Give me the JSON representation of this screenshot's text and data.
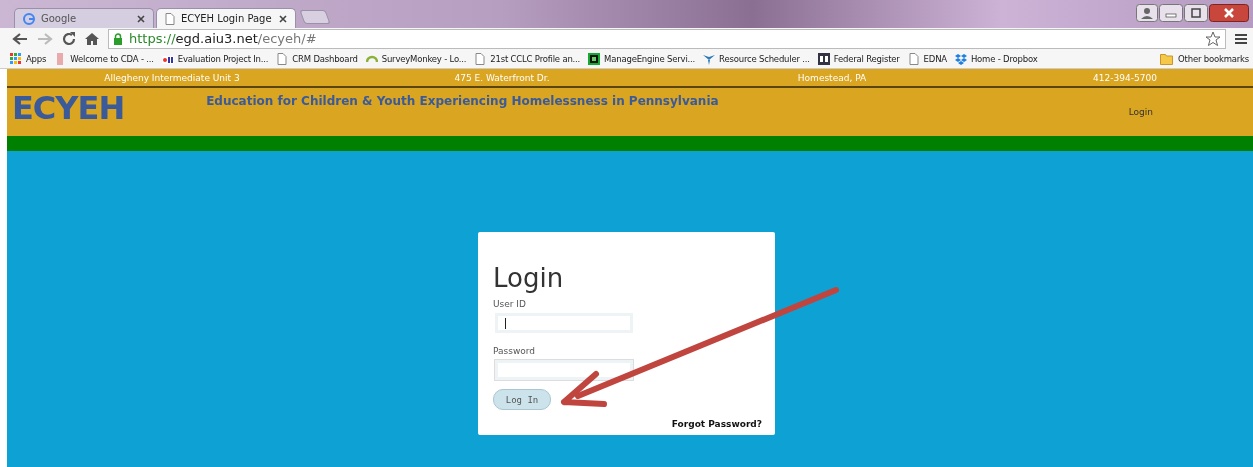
{
  "browser": {
    "tabs": [
      {
        "label": "Google",
        "selected": false
      },
      {
        "label": "ECYEH Login Page",
        "selected": true
      }
    ],
    "url": {
      "scheme": "https://",
      "host": "egd.aiu3.net",
      "path": "/ecyeh/#"
    },
    "bookmarks": [
      "Apps",
      "Welcome to CDA - ...",
      "Evaluation Project In...",
      "CRM Dashboard",
      "SurveyMonkey - Lo...",
      "21st CCLC Profile an...",
      "ManageEngine Servi...",
      "Resource Scheduler ...",
      "Federal Register",
      "EDNA",
      "Home - Dropbox"
    ],
    "other_bookmarks": "Other bookmarks"
  },
  "top_bar": [
    "Allegheny Intermediate Unit 3",
    "475 E. Waterfront Dr.",
    "Homestead, PA",
    "412-394-5700"
  ],
  "header": {
    "logo": "ECYEH",
    "tagline": "Education for Children & Youth Experiencing Homelessness in Pennsylvania",
    "nav_link": "Login"
  },
  "login": {
    "title": "Login",
    "fields": [
      {
        "label": "User ID",
        "focused": true
      },
      {
        "label": "Password",
        "focused": false
      }
    ],
    "button": "Log In",
    "forgot": "Forgot Password?"
  }
}
